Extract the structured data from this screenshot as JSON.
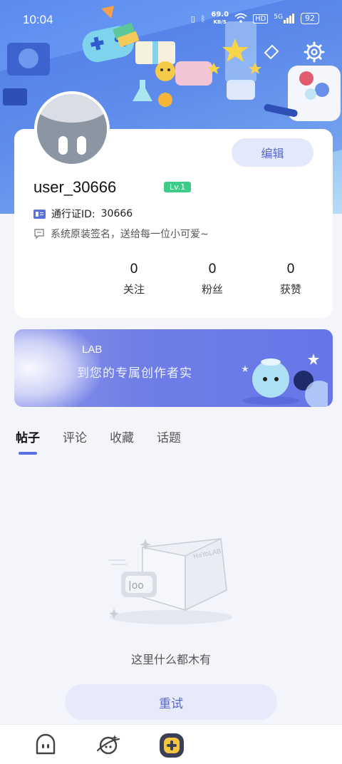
{
  "status_bar": {
    "time": "10:04",
    "net_speed": "69.0",
    "net_speed_unit": "KB/S",
    "hd": "HD",
    "network": "5G",
    "battery": "92"
  },
  "profile": {
    "username": "user_30666",
    "level": "Lv.1",
    "passport_label": "通行证ID:",
    "passport_id": "30666",
    "signature": "系统原装签名，送给每一位小可爱~",
    "edit_label": "编辑"
  },
  "stats": [
    {
      "value": "0",
      "label": "关注"
    },
    {
      "value": "0",
      "label": "粉丝"
    },
    {
      "value": "0",
      "label": "获赞"
    }
  ],
  "banner": {
    "title": "LAB",
    "subtitle": "到您的专属创作者实"
  },
  "tabs": [
    {
      "label": "帖子",
      "active": true
    },
    {
      "label": "评论",
      "active": false
    },
    {
      "label": "收藏",
      "active": false
    },
    {
      "label": "话题",
      "active": false
    }
  ],
  "empty_state": {
    "box_label": "HoYoLAB",
    "message": "这里什么都木有",
    "retry_label": "重试"
  },
  "bottom_nav": [
    {
      "icon": "home-face-icon"
    },
    {
      "icon": "planet-icon"
    },
    {
      "icon": "create-plus-icon"
    }
  ],
  "colors": {
    "accent": "#5b6ee0",
    "level_badge": "#3dcc88",
    "button_bg": "#e3e8fb",
    "button_text": "#5767c8"
  }
}
